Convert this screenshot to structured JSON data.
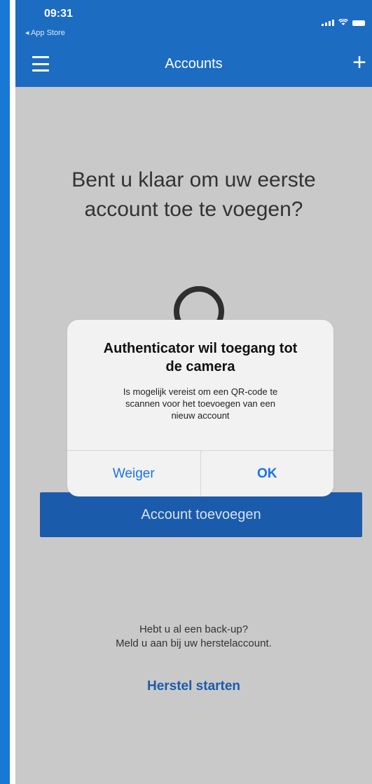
{
  "status_bar": {
    "time": "09:31",
    "back_app": "◂ App Store"
  },
  "nav": {
    "title": "Accounts",
    "add_icon": "+"
  },
  "main": {
    "headline_line1": "Bent u klaar om uw eerste",
    "headline_line2": "account toe te voegen?",
    "add_button_label": "Account toevoegen",
    "backup_line1": "Hebt u al een back-up?",
    "backup_line2": "Meld u aan bij uw herstelaccount.",
    "restore_link": "Herstel starten"
  },
  "dialog": {
    "title_line1": "Authenticator wil toegang tot",
    "title_line2": "de camera",
    "message_line1": "Is mogelijk vereist om een QR-code te",
    "message_line2": "scannen voor het toevoegen van een",
    "message_line3": "nieuw account",
    "deny_label": "Weiger",
    "ok_label": "OK"
  },
  "colors": {
    "header_blue": "#1c6cc2",
    "button_blue": "#1b5bab",
    "ios_link_blue": "#1a73e8",
    "background_gray": "#c9c9c9"
  },
  "icons": [
    "hamburger-menu-icon",
    "plus-icon",
    "signal-icon",
    "wifi-icon",
    "battery-icon",
    "camera-ring-icon"
  ]
}
